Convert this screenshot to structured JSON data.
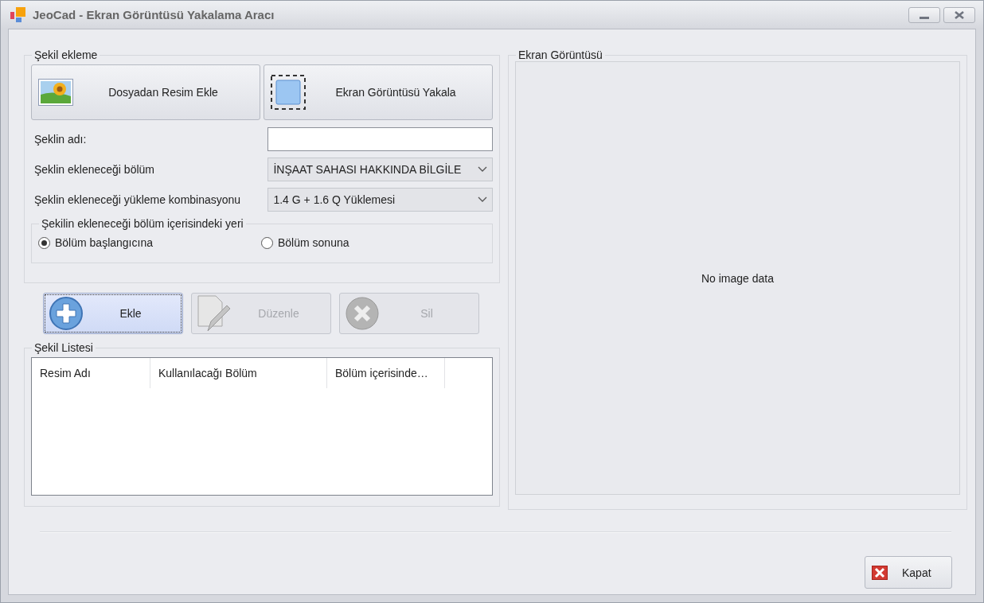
{
  "window": {
    "title": "JeoCad - Ekran Görüntüsü Yakalama Aracı"
  },
  "add_group": {
    "title": "Şekil ekleme",
    "source_buttons": [
      {
        "kind": "file",
        "label": "Dosyadan Resim Ekle"
      },
      {
        "kind": "capture",
        "label": "Ekran Görüntüsü Yakala"
      }
    ],
    "name_field": {
      "label": "Şeklin adı:"
    },
    "section_combo": {
      "label": "Şeklin ekleneceği bölüm",
      "value": "İNŞAAT SAHASI HAKKINDA BİLGİLE"
    },
    "load_combo": {
      "label": "Şeklin ekleneceği yükleme kombinasyonu",
      "value": "1.4 G + 1.6 Q Yüklemesi"
    },
    "position_group": {
      "title": "Şekilin ekleneceği bölüm içerisindeki yeri",
      "options": [
        {
          "label": "Bölüm başlangıcına",
          "selected": true
        },
        {
          "label": "Bölüm sonuna",
          "selected": false
        }
      ]
    }
  },
  "actions": [
    {
      "kind": "add",
      "label": "Ekle",
      "disabled": false,
      "focused": true
    },
    {
      "kind": "edit",
      "label": "Düzenle",
      "disabled": true,
      "focused": false
    },
    {
      "kind": "delete",
      "label": "Sil",
      "disabled": true,
      "focused": false
    }
  ],
  "list_group": {
    "title": "Şekil Listesi",
    "columns": [
      "Resim Adı",
      "Kullanılacağı Bölüm",
      "Bölüm içerisinde…"
    ]
  },
  "preview": {
    "title": "Ekran Görüntüsü",
    "empty_text": "No image data"
  },
  "close_button": {
    "label": "Kapat"
  }
}
